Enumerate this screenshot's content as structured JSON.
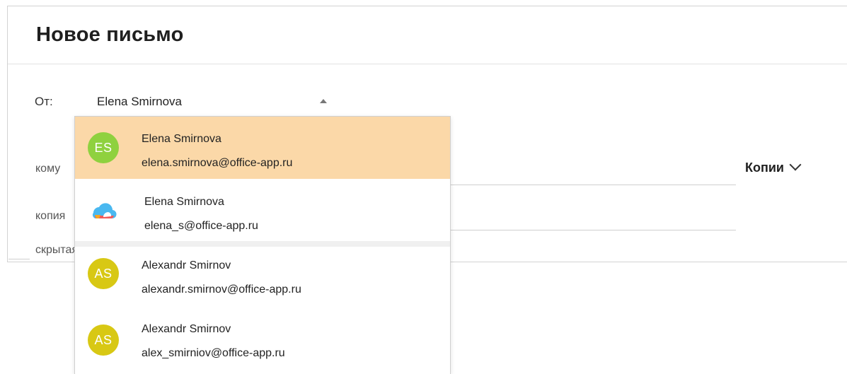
{
  "compose": {
    "title": "Новое письмо",
    "from_label": "От:",
    "from_value": "Elena Smirnova",
    "to_label": "кому",
    "cc_label": "копия",
    "bcc_label": "скрытая",
    "cc_toggle": "Копии"
  },
  "accounts": [
    {
      "initials": "ES",
      "name": "Elena Smirnova",
      "email": "elena.smirnova@office-app.ru",
      "avatar_color": "#8fd13f",
      "selected": true
    },
    {
      "initials": "",
      "name": "Elena Smirnova",
      "email": "elena_s@office-app.ru",
      "icon": "cloud-icon",
      "selected": false
    },
    {
      "initials": "AS",
      "name": "Alexandr Smirnov",
      "email": "alexandr.smirnov@office-app.ru",
      "avatar_color": "#d8c814",
      "selected": false
    },
    {
      "initials": "AS",
      "name": "Alexandr Smirnov",
      "email": "alex_smirniov@office-app.ru",
      "avatar_color": "#d8c814",
      "selected": false
    }
  ],
  "colors": {
    "selected_row": "#fbd8a8",
    "divider": "#d0d0d0"
  }
}
